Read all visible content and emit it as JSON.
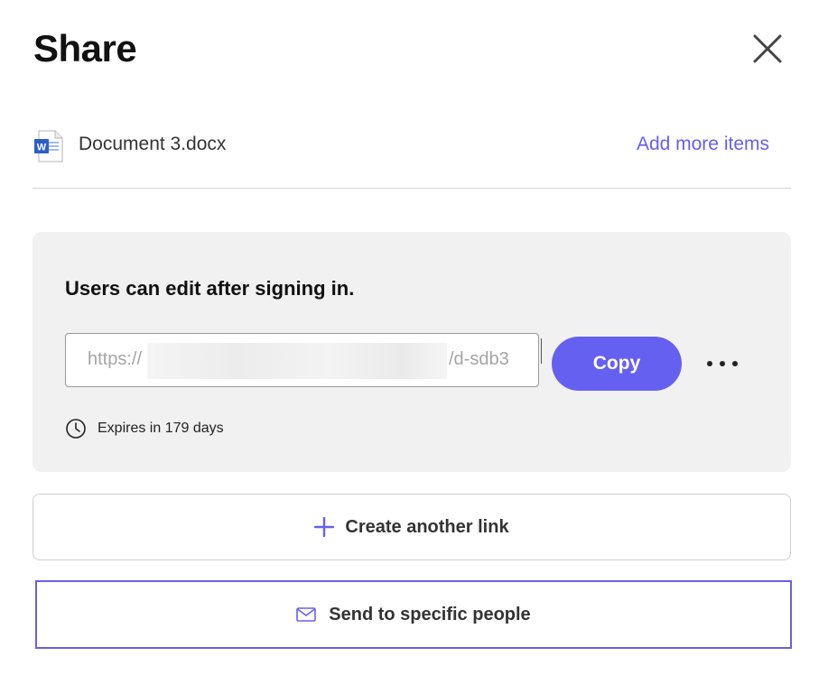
{
  "dialog": {
    "title": "Share",
    "close_icon": "close-icon"
  },
  "file": {
    "icon": "word-document-icon",
    "name": "Document 3.docx",
    "add_more_label": "Add more items"
  },
  "link_card": {
    "permission_text": "Users can edit after signing in.",
    "url_prefix": "https://",
    "url_suffix": "/d-sdb3",
    "copy_label": "Copy",
    "more_label": "•••",
    "expiry_icon": "clock-icon",
    "expiry_text": "Expires in 179 days"
  },
  "actions": {
    "create_link_icon": "plus-icon",
    "create_link_label": "Create another link",
    "send_icon": "mail-icon",
    "send_label": "Send to specific people"
  },
  "colors": {
    "accent": "#6560f0",
    "send_border": "#6a5ee8",
    "card_bg": "#f1f1f1"
  }
}
